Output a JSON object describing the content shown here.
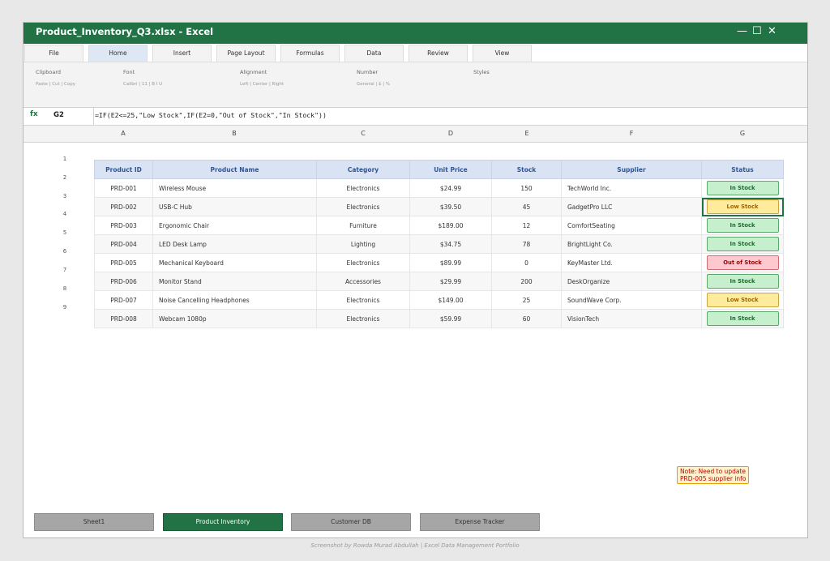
{
  "window": {
    "title": "Product_Inventory_Q3.xlsx - Excel",
    "controls": {
      "minimize": "—",
      "maximize": "☐",
      "close": "✕"
    }
  },
  "ribbon_tabs": [
    "File",
    "Home",
    "Insert",
    "Page Layout",
    "Formulas",
    "Data",
    "Review",
    "View"
  ],
  "active_tab": "Home",
  "ribbon_groups": [
    {
      "title": "Clipboard",
      "sub": "Paste | Cut | Copy"
    },
    {
      "title": "Font",
      "sub": "Calibri | 11 | B I U"
    },
    {
      "title": "Alignment",
      "sub": "Left | Center | Right"
    },
    {
      "title": "Number",
      "sub": "General | $ | %"
    },
    {
      "title": "Styles",
      "sub": ""
    }
  ],
  "formula_bar": {
    "fx": "fx",
    "cell_ref": "G2",
    "formula": "=IF(E2<=25,\"Low Stock\",IF(E2=0,\"Out of Stock\",\"In Stock\"))"
  },
  "columns": [
    "A",
    "B",
    "C",
    "D",
    "E",
    "F",
    "G"
  ],
  "row_numbers": [
    "1",
    "2",
    "3",
    "4",
    "5",
    "6",
    "7",
    "8",
    "9"
  ],
  "table": {
    "headers": [
      "Product ID",
      "Product Name",
      "Category",
      "Unit Price",
      "Stock",
      "Supplier",
      "Status"
    ],
    "rows": [
      [
        "PRD-001",
        "Wireless Mouse",
        "Electronics",
        "$24.99",
        "150",
        "TechWorld Inc.",
        "In Stock"
      ],
      [
        "PRD-002",
        "USB-C Hub",
        "Electronics",
        "$39.50",
        "45",
        "GadgetPro LLC",
        "Low Stock"
      ],
      [
        "PRD-003",
        "Ergonomic Chair",
        "Furniture",
        "$189.00",
        "12",
        "ComfortSeating",
        "In Stock"
      ],
      [
        "PRD-004",
        "LED Desk Lamp",
        "Lighting",
        "$34.75",
        "78",
        "BrightLight Co.",
        "In Stock"
      ],
      [
        "PRD-005",
        "Mechanical Keyboard",
        "Electronics",
        "$89.99",
        "0",
        "KeyMaster Ltd.",
        "Out of Stock"
      ],
      [
        "PRD-006",
        "Monitor Stand",
        "Accessories",
        "$29.99",
        "200",
        "DeskOrganize",
        "In Stock"
      ],
      [
        "PRD-007",
        "Noise Cancelling Headphones",
        "Electronics",
        "$149.00",
        "25",
        "SoundWave Corp.",
        "Low Stock"
      ],
      [
        "PRD-008",
        "Webcam 1080p",
        "Electronics",
        "$59.99",
        "60",
        "VisionTech",
        "In Stock"
      ]
    ]
  },
  "status_colors": {
    "In Stock": "#c6efce",
    "Low Stock": "#ffeb9c",
    "Out of Stock": "#ffc7ce"
  },
  "note": {
    "line1": "Note: Need to update",
    "line2": "PRD-005 supplier info"
  },
  "sheet_tabs": [
    "Sheet1",
    "Product Inventory",
    "Customer DB",
    "Expense Tracker"
  ],
  "active_sheet": "Product Inventory",
  "caption": "Screenshot by Rowda Murad Abdullah | Excel Data Management Portfolio"
}
